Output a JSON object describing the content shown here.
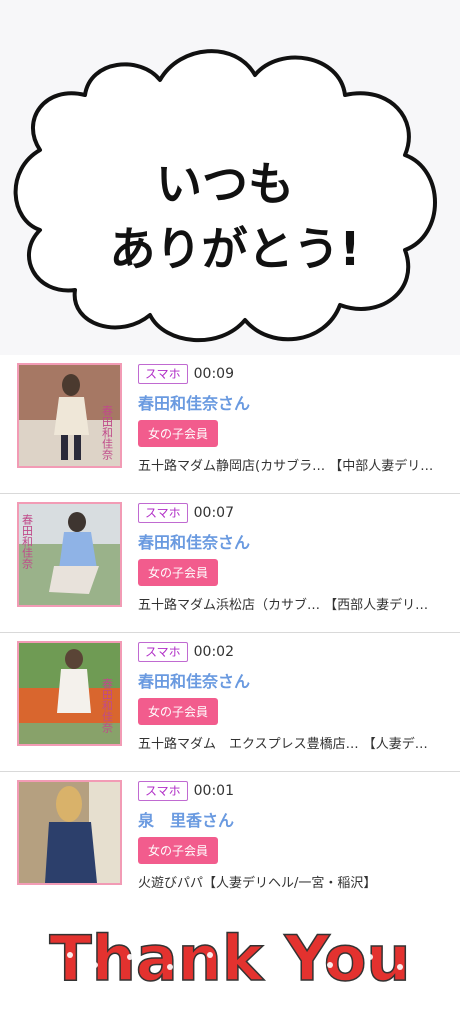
{
  "header_image": {
    "text_line1": "いつも",
    "text_line2": "ありがとう!"
  },
  "list": [
    {
      "badge": "スマホ",
      "time": "00:09",
      "name": "春田和佳奈さん",
      "button": "女の子会員",
      "shop": "五十路マダム静岡店(カサブラ… 【中部人妻デリヘ…"
    },
    {
      "badge": "スマホ",
      "time": "00:07",
      "name": "春田和佳奈さん",
      "button": "女の子会員",
      "shop": "五十路マダム浜松店（カサブ… 【西部人妻デリヘル…"
    },
    {
      "badge": "スマホ",
      "time": "00:02",
      "name": "春田和佳奈さん",
      "button": "女の子会員",
      "shop": "五十路マダム　エクスプレス豊橋店… 【人妻デリ…"
    },
    {
      "badge": "スマホ",
      "time": "00:01",
      "name": "泉　里香さん",
      "button": "女の子会員",
      "shop": "火遊びパパ【人妻デリヘル/一宮・稲沢】"
    }
  ],
  "footer_image": {
    "text": "Thank You"
  },
  "colors": {
    "badge": "#b02ec7",
    "name": "#6a9ae0",
    "button": "#f25c8d",
    "thumb_border": "#f29bb5"
  }
}
